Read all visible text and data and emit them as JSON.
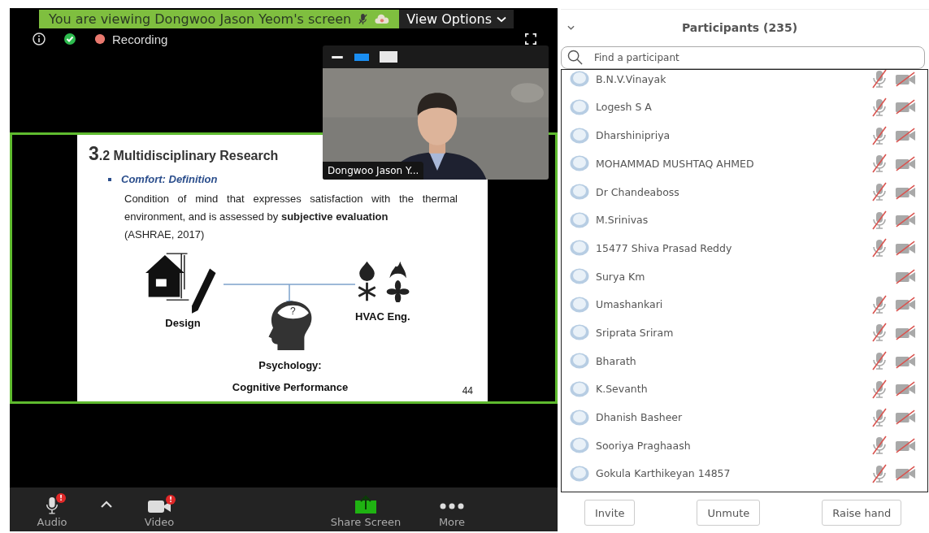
{
  "banner": {
    "text": "You are viewing Dongwoo Jason Yeom's screen",
    "view_options": "View Options"
  },
  "meeting_bar": {
    "recording": "Recording"
  },
  "slide": {
    "title_number": "3",
    "title": ".2 Multidisciplinary Research",
    "bullet": "Comfort: Definition",
    "paragraph": "Condition of mind that expresses satisfaction with the thermal environment, and is assessed by **subjective evaluation**",
    "citation": "(ASHRAE, 2017)",
    "question_mark": "?",
    "design_label": "Design",
    "hvac_label": "HVAC Eng.",
    "psychology_label": "Psychology:",
    "cognitive_label": "Cognitive Performance",
    "page_number": "44"
  },
  "video_tile": {
    "name": "Dongwoo Jason Y..."
  },
  "toolbar": [
    {
      "kind": "audio",
      "label": "Audio",
      "badge": "!"
    },
    {
      "kind": "caret"
    },
    {
      "kind": "video",
      "label": "Video",
      "badge": "!"
    },
    {
      "kind": "share",
      "label": "Share Screen"
    },
    {
      "kind": "more",
      "label": "More"
    }
  ],
  "participants_panel": {
    "title": "Participants (235)",
    "search": {
      "placeholder": "Find a participant"
    },
    "participants": [
      {
        "name": "B.N.V.Vinayak",
        "has_audio": true
      },
      {
        "name": "Logesh S A",
        "has_audio": true
      },
      {
        "name": "Dharshinipriya",
        "has_audio": true
      },
      {
        "name": "MOHAMMAD MUSHTAQ AHMED",
        "has_audio": true
      },
      {
        "name": "Dr Chandeaboss",
        "has_audio": true
      },
      {
        "name": "M.Srinivas",
        "has_audio": true
      },
      {
        "name": "15477 Shiva Prasad Reddy",
        "has_audio": true
      },
      {
        "name": "Surya Km",
        "has_audio": false
      },
      {
        "name": "Umashankari",
        "has_audio": true
      },
      {
        "name": "Sriprata Sriram",
        "has_audio": true
      },
      {
        "name": "Bharath",
        "has_audio": true
      },
      {
        "name": "K.Sevanth",
        "has_audio": true
      },
      {
        "name": "Dhanish Basheer",
        "has_audio": true
      },
      {
        "name": "Sooriya Praghaash",
        "has_audio": true
      },
      {
        "name": "Gokula Karthikeyan 14857",
        "has_audio": true
      }
    ],
    "buttons": [
      "Invite",
      "Unmute",
      "Raise hand"
    ]
  }
}
